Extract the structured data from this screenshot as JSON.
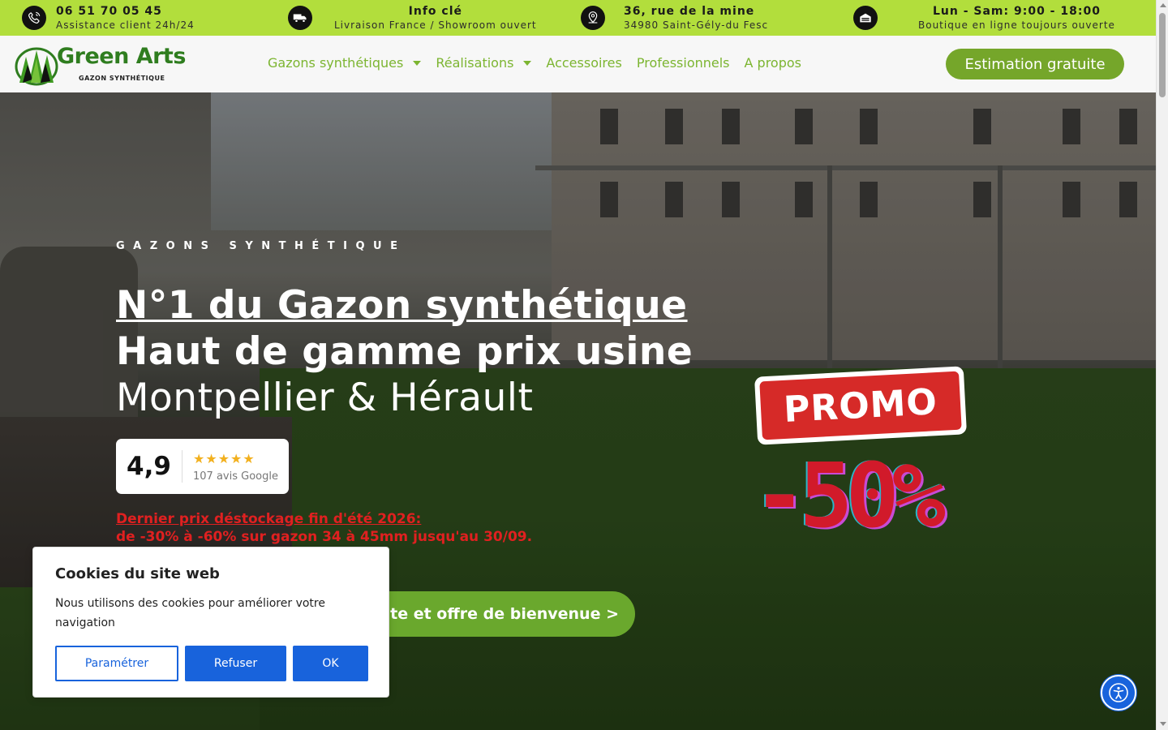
{
  "topbar": {
    "phone": {
      "title": "06 51 70 05 45",
      "sub": "Assistance client 24h/24",
      "icon": "phone-icon"
    },
    "info": {
      "title": "Info clé",
      "sub": "Livraison France / Showroom ouvert",
      "icon": "truck-icon"
    },
    "address": {
      "title": "36, rue de la mine",
      "sub": "34980 Saint-Gély-du Fesc",
      "icon": "map-pin-icon"
    },
    "hours": {
      "title": "Lun - Sam: 9:00 - 18:00",
      "sub": "Boutique en ligne toujours ouverte",
      "icon": "store-icon"
    },
    "bg_color": "#b2de3c"
  },
  "header": {
    "logo": {
      "name": "Green Arts",
      "tagline": "GAZON SYNTHÉTIQUE"
    },
    "nav": [
      {
        "label": "Gazons synthétiques",
        "has_dropdown": true
      },
      {
        "label": "Réalisations",
        "has_dropdown": true
      },
      {
        "label": "Accessoires",
        "has_dropdown": false
      },
      {
        "label": "Professionnels",
        "has_dropdown": false
      },
      {
        "label": "A propos",
        "has_dropdown": false
      }
    ],
    "cta_label": "Estimation gratuite",
    "accent_color": "#75a62a"
  },
  "hero": {
    "eyebrow": "GAZONS SYNTHÉTIQUE",
    "title_line1": "N°1 du Gazon synthétique",
    "title_line2": "Haut de gamme prix usine",
    "title_line3": "Montpellier & Hérault",
    "rating": {
      "score": "4,9",
      "stars": 5,
      "count_text": "107 avis Google"
    },
    "promo_line1": "Dernier prix déstockage fin d'été 2026:",
    "promo_line2": "de -30% à -60% sur gazon 34 à 45mm jusqu'au 30/09.",
    "button_label": "uite et offre de bienvenue >",
    "stamp_text": "PROMO",
    "discount_text": "-50%"
  },
  "cookie": {
    "title": "Cookies du site web",
    "text": "Nous utilisons des cookies pour améliorer votre navigation",
    "settings_label": "Paramétrer",
    "refuse_label": "Refuser",
    "ok_label": "OK",
    "button_color": "#1863dc"
  },
  "accessibility": {
    "icon": "accessibility-icon"
  }
}
